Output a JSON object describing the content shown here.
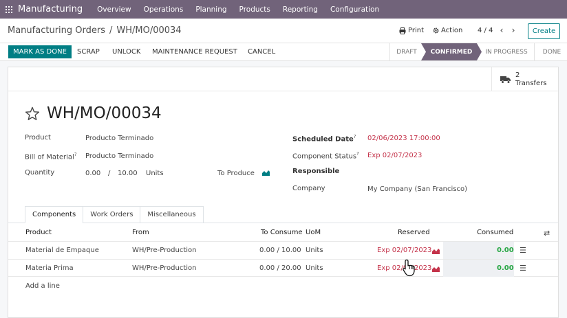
{
  "navbar": {
    "app_name": "Manufacturing",
    "menu": [
      "Overview",
      "Operations",
      "Planning",
      "Products",
      "Reporting",
      "Configuration"
    ]
  },
  "control_panel": {
    "breadcrumb_parent": "Manufacturing Orders",
    "breadcrumb_sep": "/",
    "breadcrumb_current": "WH/MO/00034",
    "print_label": "Print",
    "action_label": "Action",
    "pager": "4 / 4",
    "create_label": "Create"
  },
  "statusbar": {
    "buttons": {
      "mark_done": "MARK AS DONE",
      "scrap": "SCRAP",
      "unlock": "UNLOCK",
      "maintenance": "MAINTENANCE REQUEST",
      "cancel": "CANCEL"
    },
    "stages": [
      "DRAFT",
      "CONFIRMED",
      "IN PROGRESS",
      "DONE"
    ],
    "active_stage": "CONFIRMED"
  },
  "smart_button": {
    "count": "2",
    "label": "Transfers"
  },
  "record": {
    "title": "WH/MO/00034",
    "fields": {
      "product_label": "Product",
      "product_value": "Producto Terminado",
      "bom_label": "Bill of Material",
      "bom_value": "Producto Terminado",
      "qty_label": "Quantity",
      "qty_produced": "0.00",
      "qty_sep": "/",
      "qty_total": "10.00",
      "qty_uom": "Units",
      "to_produce_label": "To Produce",
      "scheduled_label": "Scheduled Date",
      "scheduled_value": "02/06/2023 17:00:00",
      "component_status_label": "Component Status",
      "component_status_value": "Exp 02/07/2023",
      "responsible_label": "Responsible",
      "company_label": "Company",
      "company_value": "My Company (San Francisco)",
      "help_mark": "?"
    }
  },
  "tabs": [
    "Components",
    "Work Orders",
    "Miscellaneous"
  ],
  "table": {
    "headers": {
      "product": "Product",
      "from": "From",
      "to_consume": "To Consume",
      "uom": "UoM",
      "reserved": "Reserved",
      "consumed": "Consumed"
    },
    "rows": [
      {
        "product": "Material de Empaque",
        "from": "WH/Pre-Production",
        "to_consume": "0.00 /  10.00",
        "uom": "Units",
        "reserved": "Exp 02/07/2023",
        "consumed": "0.00"
      },
      {
        "product": "Materia Prima",
        "from": "WH/Pre-Production",
        "to_consume": "0.00 /  20.00",
        "uom": "Units",
        "reserved": "Exp 02/07/2023",
        "consumed": "0.00"
      }
    ],
    "add_line": "Add a line"
  },
  "colors": {
    "navbar": "#71637a",
    "primary": "#017e84",
    "danger": "#c4334a",
    "success": "#28a745"
  }
}
